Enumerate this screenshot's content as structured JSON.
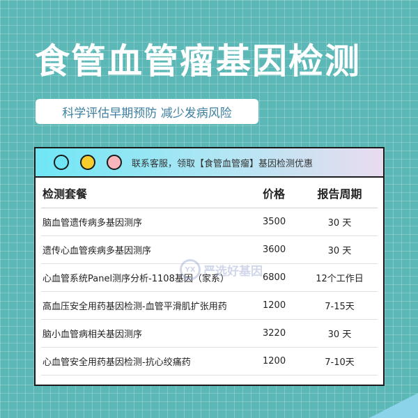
{
  "title": "食管血管瘤基因检测",
  "subtitle": "科学评估早期预防 减少发病风险",
  "card": {
    "header_text": "联系客服，领取【食管血管瘤】基因检测优惠",
    "columns": [
      "检测套餐",
      "价格",
      "报告周期"
    ],
    "rows": [
      {
        "name": "脑血管遗传病多基因测序",
        "price": "3500",
        "period": "30 天"
      },
      {
        "name": "遗传心血管疾病多基因测序",
        "price": "3600",
        "period": "30 天"
      },
      {
        "name": "心血管系统Panel测序分析-1108基因（家系）",
        "price": "6800",
        "period": "12个工作日"
      },
      {
        "name": "高血压安全用药基因检测-血管平滑肌扩张用药",
        "price": "1200",
        "period": "7-15天"
      },
      {
        "name": "脑小血管病相关基因测序",
        "price": "3220",
        "period": "30 天"
      },
      {
        "name": "心血管安全用药基因检测-抗心绞痛药",
        "price": "1200",
        "period": "7-10天"
      }
    ]
  },
  "watermark": {
    "logo": "YX",
    "text": "严选好基因"
  },
  "colors": {
    "background": "#5bb8b6",
    "subtitle": "#3d7fa0",
    "dot_cyan": "#6fe6f5",
    "dot_yellow": "#f7cd2e",
    "dot_pink": "#f6b6bc"
  }
}
